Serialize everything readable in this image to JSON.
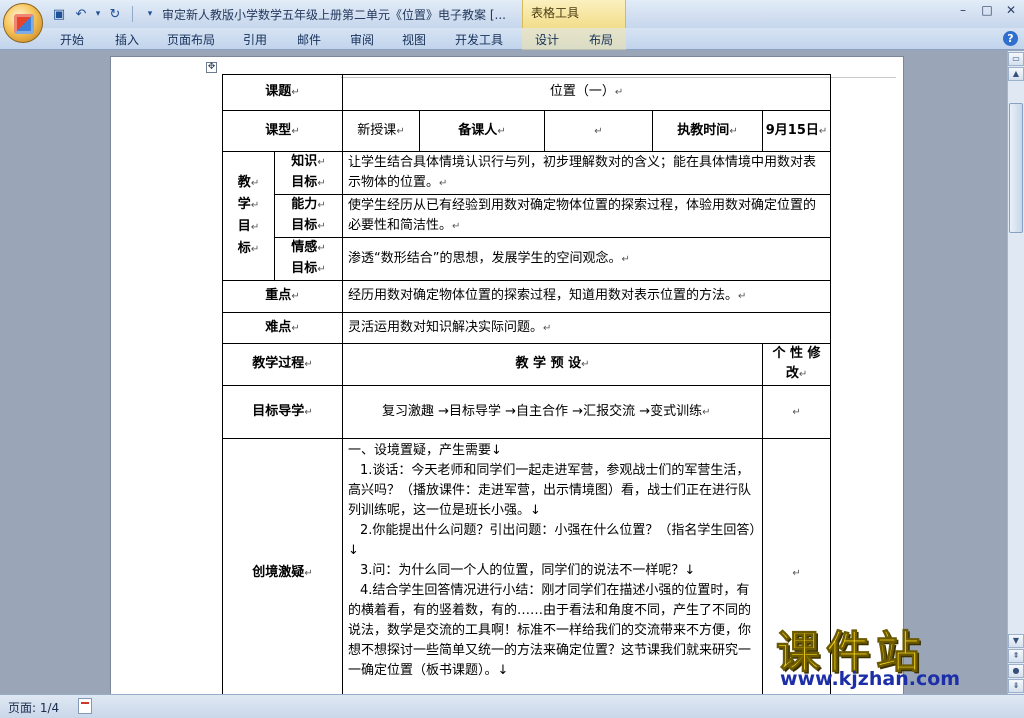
{
  "window": {
    "title": "审定新人教版小学数学五年级上册第二单元《位置》电子教案 [...",
    "context_tab": "表格工具",
    "controls": [
      "–",
      "□",
      "✕"
    ]
  },
  "qat": {
    "save": "▣",
    "undo": "↶",
    "redo": "↻",
    "more": "▾"
  },
  "ribbon_tabs": [
    "开始",
    "插入",
    "页面布局",
    "引用",
    "邮件",
    "审阅",
    "视图",
    "开发工具",
    "设计",
    "布局"
  ],
  "help": "?",
  "table": {
    "handle": "✥",
    "pm": "↵",
    "topic_label": "课题",
    "topic": "位置（一）",
    "type_label": "课型",
    "type": "新授课",
    "prep_label": "备课人",
    "prep": "",
    "date_label": "执教时间",
    "date": "9月15日",
    "goal_label_chars": [
      "教",
      "学",
      "目",
      "标"
    ],
    "goals": [
      {
        "label_lines": [
          "知识",
          "目标"
        ],
        "text": "让学生结合具体情境认识行与列，初步理解数对的含义；能在具体情境中用数对表示物体的位置。"
      },
      {
        "label_lines": [
          "能力",
          "目标"
        ],
        "text": "使学生经历从已有经验到用数对确定物体位置的探索过程，体验用数对确定位置的必要性和简洁性。"
      },
      {
        "label_lines": [
          "情感",
          "目标"
        ],
        "text": "渗透“数形结合”的思想，发展学生的空间观念。"
      }
    ],
    "key_label": "重点",
    "key": "经历用数对确定物体位置的探索过程，知道用数对表示位置的方法。",
    "difficulty_label": "难点",
    "difficulty": "灵活运用数对知识解决实际问题。",
    "process_label": "教学过程",
    "preset_label": "教 学 预 设",
    "modify_label": "个 性 修 改",
    "guide_label": "目标导学",
    "guide": "复习激趣 →目标导学 →自主合作 →汇报交流 →变式训练",
    "scene_label": "创境激疑",
    "scene_paragraphs": [
      "一、设境置疑，产生需要↓",
      "1.谈话：今天老师和同学们一起走进军营，参观战士们的军营生活，高兴吗？（播放课件：走进军营，出示情境图）看，战士们正在进行队列训练呢，这一位是班长小强。↓",
      "2.你能提出什么问题？引出问题：小强在什么位置？（指名学生回答）↓",
      "3.问：为什么同一个人的位置，同学们的说法不一样呢？↓",
      "4.结合学生回答情况进行小结：刚才同学们在描述小强的位置时，有的横着看，有的竖着数，有的……由于看法和角度不同，产生了不同的说法，数学是交流的工具啊！标准不一样给我们的交流带来不方便，你想不想探讨一些简单又统一的方法来确定位置？这节课我们就来研究一一确定位置（板书课题）。↓"
    ]
  },
  "status": {
    "page": "页面: 1/4"
  },
  "watermark": {
    "title": "课件站",
    "url": "www.kjzhan.com"
  },
  "scrollbar": {
    "up": "▲",
    "down": "▼",
    "split": "▭",
    "prev": "⇞",
    "next": "⇟",
    "select": "●"
  }
}
